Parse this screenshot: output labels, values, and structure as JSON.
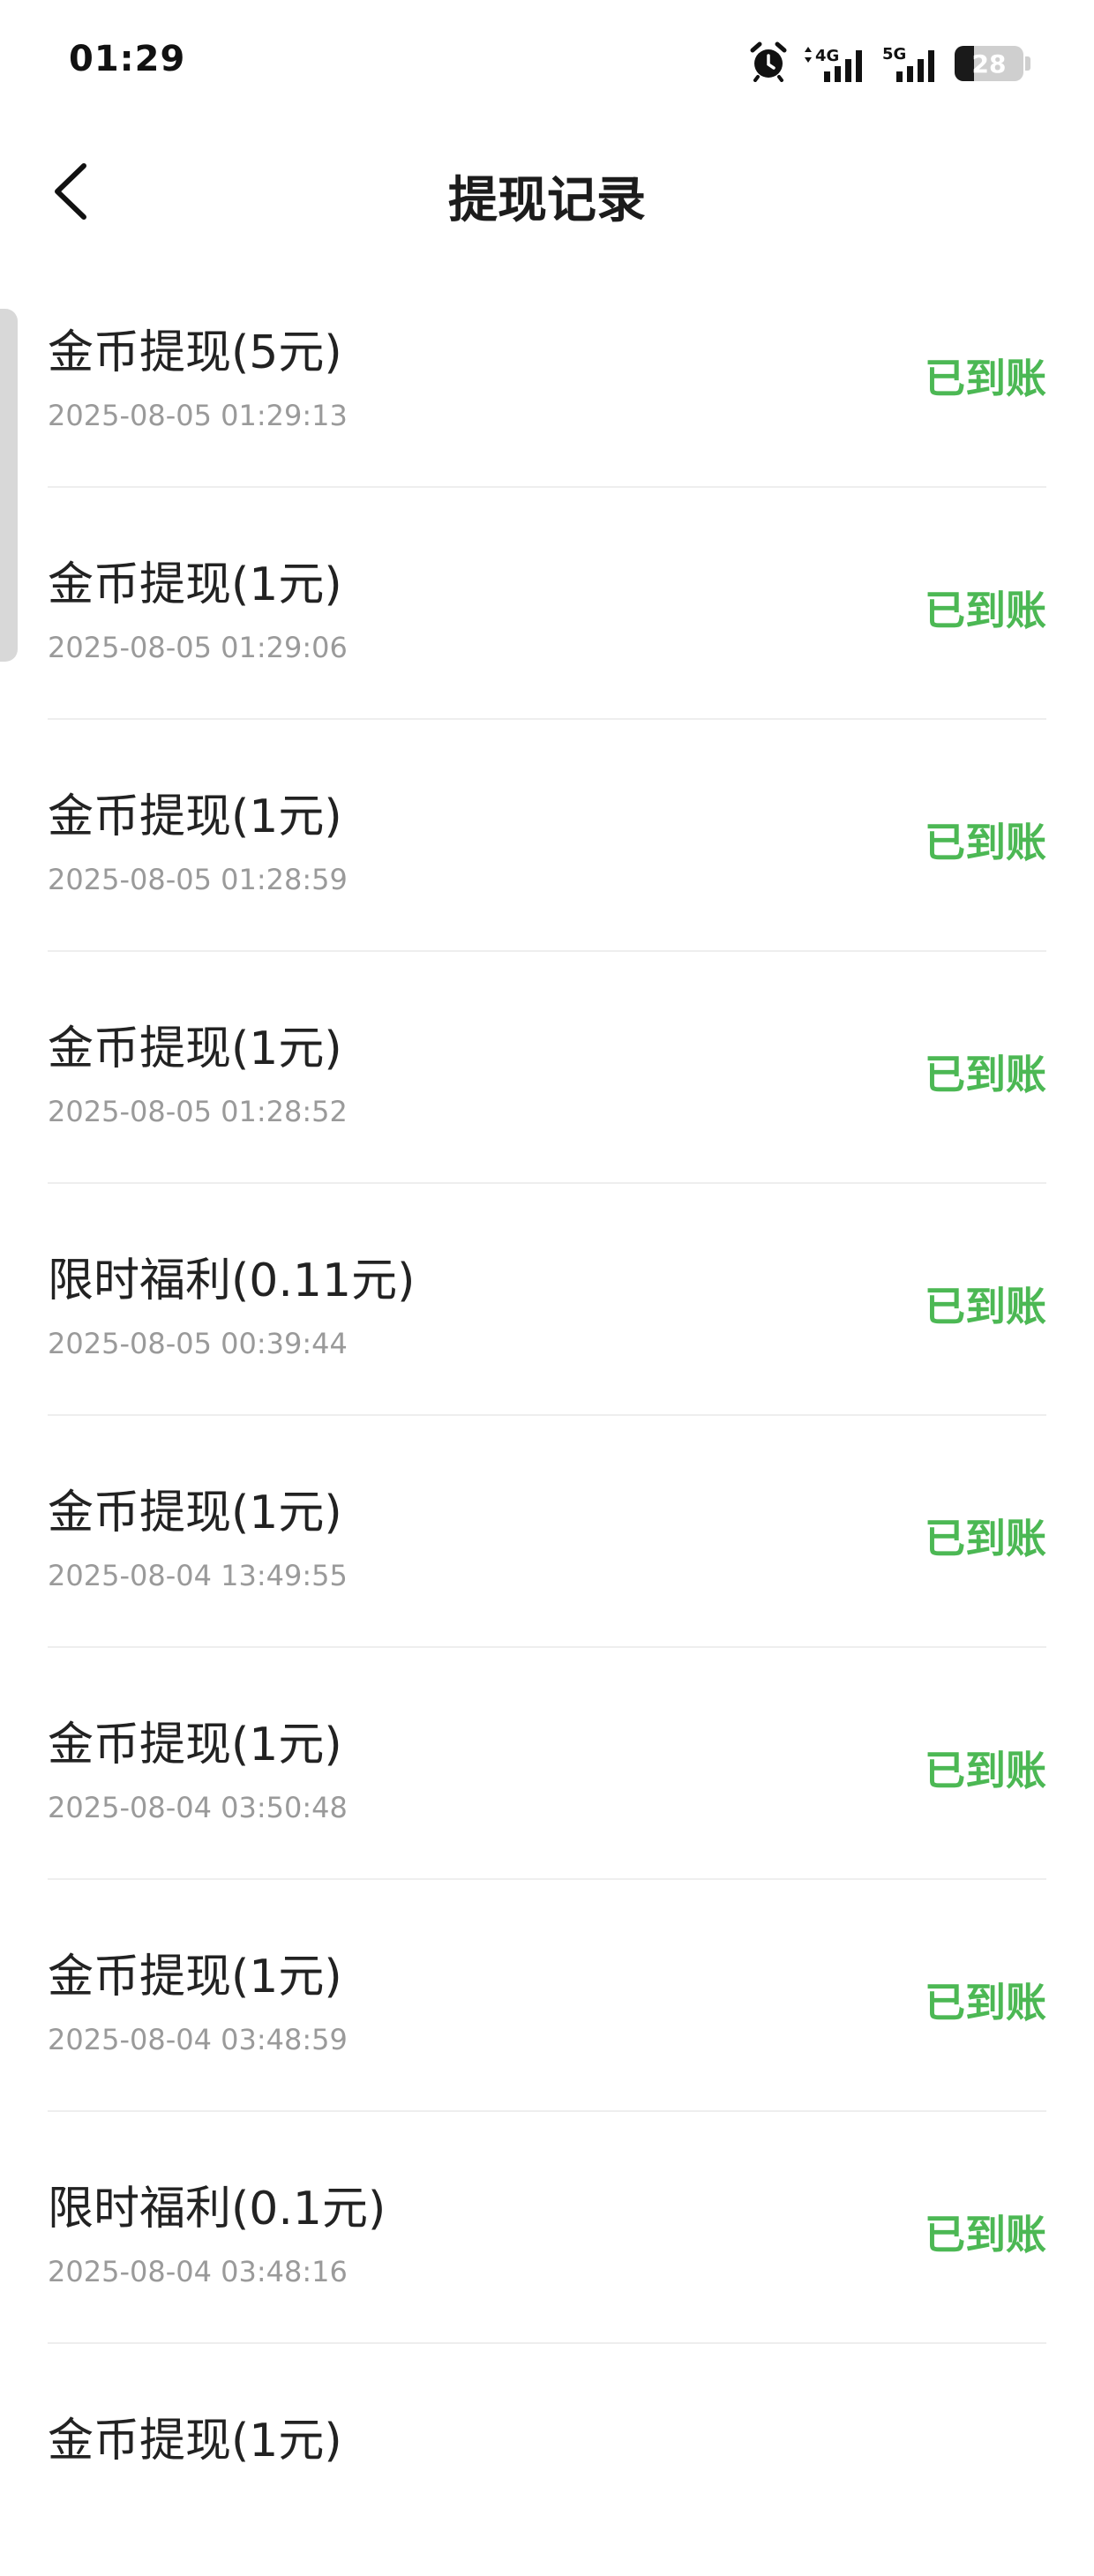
{
  "status_bar": {
    "time": "01:29",
    "network_4g": "4G",
    "network_5g": "5G",
    "battery_level": "28"
  },
  "header": {
    "title": "提现记录"
  },
  "records": [
    {
      "title": "金币提现(5元)",
      "time": "2025-08-05 01:29:13",
      "status": "已到账"
    },
    {
      "title": "金币提现(1元)",
      "time": "2025-08-05 01:29:06",
      "status": "已到账"
    },
    {
      "title": "金币提现(1元)",
      "time": "2025-08-05 01:28:59",
      "status": "已到账"
    },
    {
      "title": "金币提现(1元)",
      "time": "2025-08-05 01:28:52",
      "status": "已到账"
    },
    {
      "title": "限时福利(0.11元)",
      "time": "2025-08-05 00:39:44",
      "status": "已到账"
    },
    {
      "title": "金币提现(1元)",
      "time": "2025-08-04 13:49:55",
      "status": "已到账"
    },
    {
      "title": "金币提现(1元)",
      "time": "2025-08-04 03:50:48",
      "status": "已到账"
    },
    {
      "title": "金币提现(1元)",
      "time": "2025-08-04 03:48:59",
      "status": "已到账"
    },
    {
      "title": "限时福利(0.1元)",
      "time": "2025-08-04 03:48:16",
      "status": "已到账"
    },
    {
      "title": "金币提现(1元)",
      "time": "",
      "status": ""
    }
  ],
  "colors": {
    "status_green": "#4cb854",
    "text_primary": "#222222",
    "text_secondary": "#9a9a9a"
  }
}
